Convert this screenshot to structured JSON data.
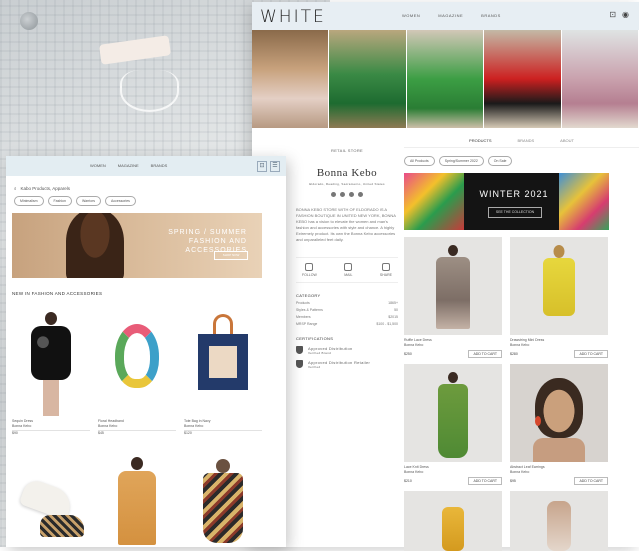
{
  "desktop": {
    "logo": "WHITE",
    "menu": [
      "WOMEN",
      "MAGAZINE",
      "BRANDS"
    ],
    "store": {
      "label": "RETAIL STORE",
      "name": "Bonna Kebo",
      "tagline": "Eldorado, Reading, Sacramento, United States",
      "description": "BONNA KEBO STORE WITH OF ELDORADO IS A FASHION BOUTIQUE IN UNITED NEW YORK, BONNA KEBO has a vision to elevate the women and man's fashion and accessories with style and chance. A highly Extremely product. Its own the Bonna Kebo accessories and unparalleled feet daily."
    },
    "actions": [
      "FOLLOW",
      "MAIL",
      "SHARE"
    ],
    "info_title": "CATEGORY",
    "info_rows": [
      {
        "k": "Products",
        "v": "1865+"
      },
      {
        "k": "Styles & Patterns",
        "v": "50"
      },
      {
        "k": "Members",
        "v": "$2015"
      },
      {
        "k": "MRSP Range",
        "v": "$100 - $1,500"
      }
    ],
    "cert_title": "CERTIFICATIONS",
    "certs": [
      {
        "name": "Approved Distribution",
        "sub": "Verified Brand"
      },
      {
        "name": "Approved Distribution Retailer",
        "sub": "Verified"
      }
    ],
    "tabs": [
      "PRODUCTS",
      "BRANDS",
      "ABOUT"
    ],
    "chips": [
      "All Products",
      "Spring/Summer 2022",
      "On Sale"
    ],
    "banner": {
      "title": "WINTER 2021",
      "button": "SEE THE COLLECTION"
    },
    "products": [
      {
        "name": "Ruffle Lace Dress",
        "brand": "Bonna Kebo",
        "price": "$250",
        "button": "ADD TO CART"
      },
      {
        "name": "Drawstring Mini Dress",
        "brand": "Bonna Kebo",
        "price": "$280",
        "button": "ADD TO CART"
      },
      {
        "name": "Lace Knit Dress",
        "brand": "Bonna Kebo",
        "price": "$210",
        "button": "ADD TO CART"
      },
      {
        "name": "Abstract Leaf Earrings",
        "brand": "Bonna Kebo",
        "price": "$95",
        "button": "ADD TO CART"
      }
    ]
  },
  "tablet": {
    "menu": [
      "WOMEN",
      "MAGAZINE",
      "BRANDS"
    ],
    "search_text": "Kabo Products, Apparels",
    "chips": [
      "Minimalism",
      "Fashion",
      "Warriors",
      "Accessories"
    ],
    "banner": {
      "title": "SPRING / SUMMER FASHION AND ACCESSORIES",
      "button": "SHOP NOW"
    },
    "section_title": "NEW IN FASHION AND ACCESSORIES",
    "products": [
      {
        "name": "Sequin Dress",
        "brand": "Bonna Kebo",
        "price": "$90"
      },
      {
        "name": "Floral Headband",
        "brand": "Bonna Kebo",
        "price": "$45"
      },
      {
        "name": "Tote Bag in Navy",
        "brand": "Bonna Kebo",
        "price": "$120"
      }
    ]
  },
  "colors": {
    "nav_bg": "#e7eef3",
    "text": "#333333",
    "banner_dark": "#141414"
  }
}
